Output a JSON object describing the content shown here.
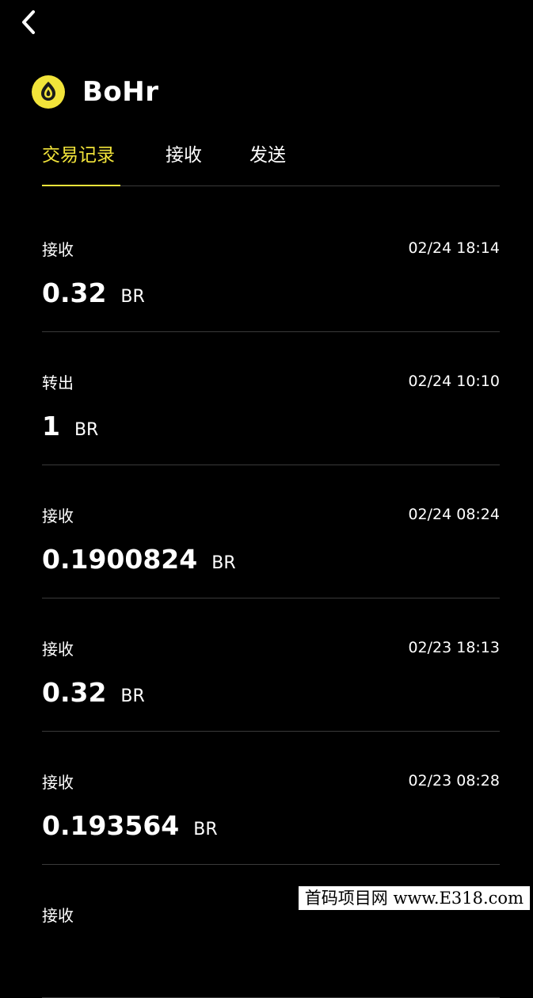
{
  "app": {
    "title": "BoHr",
    "logo_icon": "bohr-logo-icon",
    "accent_color": "#f2e43a"
  },
  "nav": {
    "back_icon": "chevron-left-icon"
  },
  "tabs": [
    {
      "label": "交易记录",
      "active": true
    },
    {
      "label": "接收",
      "active": false
    },
    {
      "label": "发送",
      "active": false
    }
  ],
  "transactions": [
    {
      "type": "接收",
      "time": "02/24 18:14",
      "amount": "0.32",
      "unit": "BR"
    },
    {
      "type": "转出",
      "time": "02/24 10:10",
      "amount": "1",
      "unit": "BR"
    },
    {
      "type": "接收",
      "time": "02/24 08:24",
      "amount": "0.1900824",
      "unit": "BR"
    },
    {
      "type": "接收",
      "time": "02/23 18:13",
      "amount": "0.32",
      "unit": "BR"
    },
    {
      "type": "接收",
      "time": "02/23 08:28",
      "amount": "0.193564",
      "unit": "BR"
    },
    {
      "type": "接收",
      "time": "",
      "amount": "",
      "unit": ""
    }
  ],
  "watermark": {
    "text": "首码项目网 www.E318.com"
  }
}
